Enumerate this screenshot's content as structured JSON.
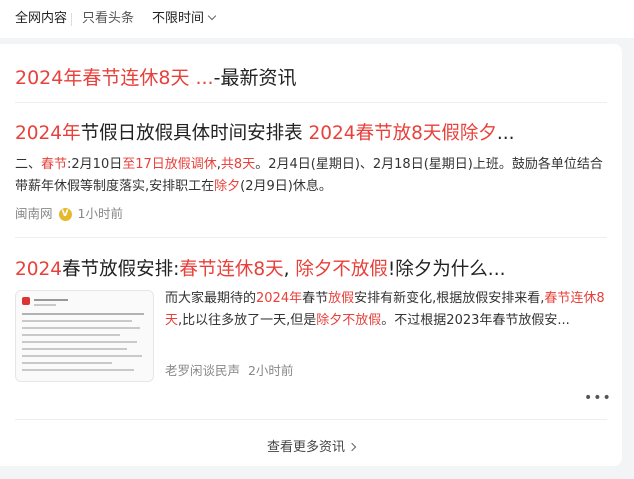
{
  "tabs": {
    "all": "全网内容",
    "toutiao": "只看头条",
    "time": "不限时间"
  },
  "head": {
    "hl": "2024年春节连休8天 ...",
    "rest": "-最新资讯"
  },
  "result1": {
    "title": [
      "2024年",
      "节假日放假具体时间安排表 ",
      "2024春节放8天假除夕",
      "..."
    ],
    "snippet": [
      "二、",
      "春节",
      ":2月10日",
      "至17日放假调休",
      ",",
      "共8天",
      "。2月4日(星期日)、2月18日(星期日)上班。鼓励各单位结合带薪年休假等制度落实,安排职工在",
      "除夕",
      "(2月9日)休息。"
    ],
    "source": "闽南网",
    "time": "1小时前"
  },
  "result2": {
    "title": [
      "2024",
      "春节放假安排:",
      "春节连休8天",
      ", ",
      "除夕不放假",
      "!除夕为什么..."
    ],
    "snippet": [
      "而大家最期待的",
      "2024年",
      "春节",
      "放假",
      "安排有新变化,根据放假安排来看,",
      "春节连休8天",
      ",比以往多放了一天,但是",
      "除夕不放假",
      "。不过根据2023年春节放假安..."
    ],
    "source": "老罗闲谈民声",
    "time": "2小时前"
  },
  "more_label": "查看更多资讯",
  "dots": "•••",
  "colors": {
    "highlight": "#e8413b",
    "source_badge": "#e6b82e"
  }
}
